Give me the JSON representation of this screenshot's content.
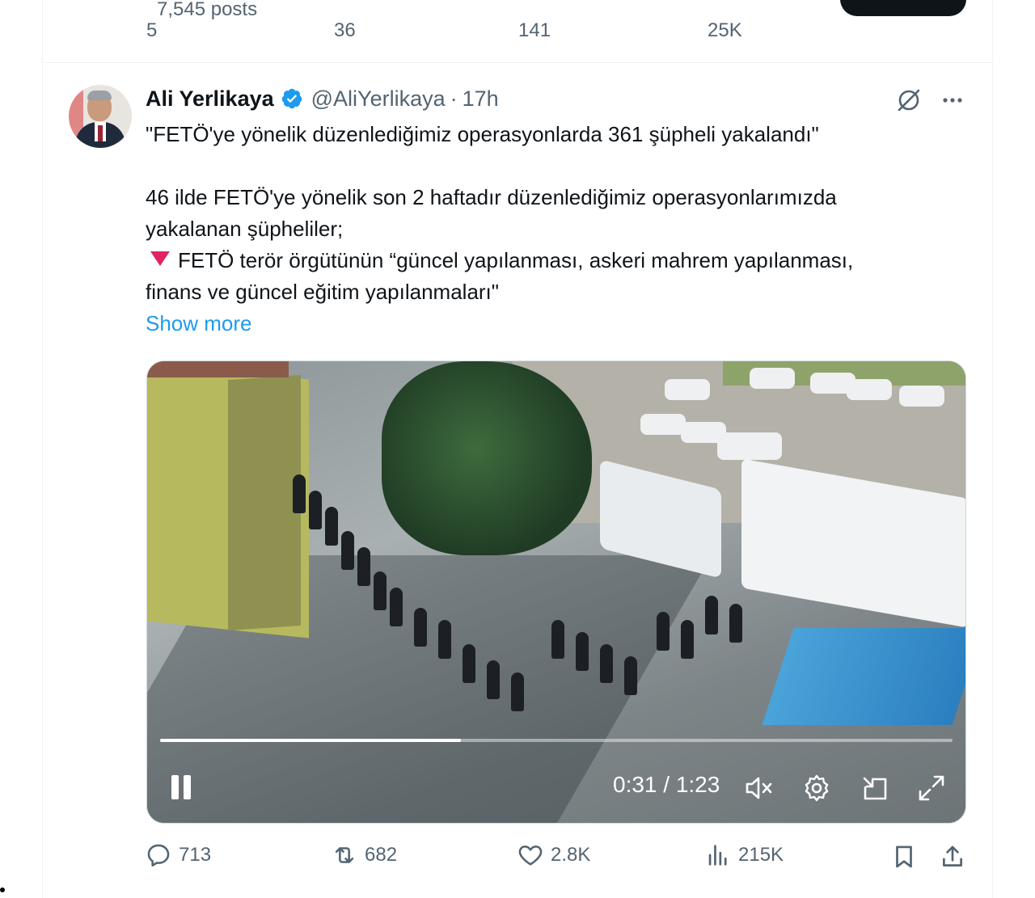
{
  "previous_tweet": {
    "posts_count": "7,545 posts",
    "replies": "5",
    "reposts": "36",
    "likes": "141",
    "views": "25K"
  },
  "tweet": {
    "author_name": "Ali Yerlikaya",
    "handle": "@AliYerlikaya",
    "separator": "·",
    "time": "17h",
    "lines": [
      "\"FETÖ'ye yönelik düzenlediğimiz operasyonlarda 361 şüpheli yakalandı\"",
      "46 ilde FETÖ'ye yönelik son 2 haftadır düzenlediğimiz operasyonlarımızda",
      "yakalanan şüpheliler;",
      "FETÖ terör örgütünün “güncel yapılanması, askeri mahrem yapılanması,",
      "finans ve güncel eğitim yapılanmaları\""
    ],
    "show_more": "Show more",
    "icons": {
      "verified": "verified-badge-icon",
      "grok": "grok-icon",
      "more": "more-icon",
      "bullet": "red-triangle-icon"
    }
  },
  "video": {
    "current_time": "0:31",
    "duration": "1:23",
    "time_display": "0:31 / 1:23",
    "progress": 0.38,
    "controls": [
      "pause-icon",
      "muted-icon",
      "settings-icon",
      "picture-in-picture-icon",
      "fullscreen-icon"
    ]
  },
  "actions": {
    "replies": "713",
    "reposts": "682",
    "likes": "2.8K",
    "views": "215K"
  },
  "colors": {
    "accent": "#1d9bf0",
    "secondary_text": "#536471",
    "primary_text": "#0f1419",
    "bullet_red": "#e0245e"
  }
}
